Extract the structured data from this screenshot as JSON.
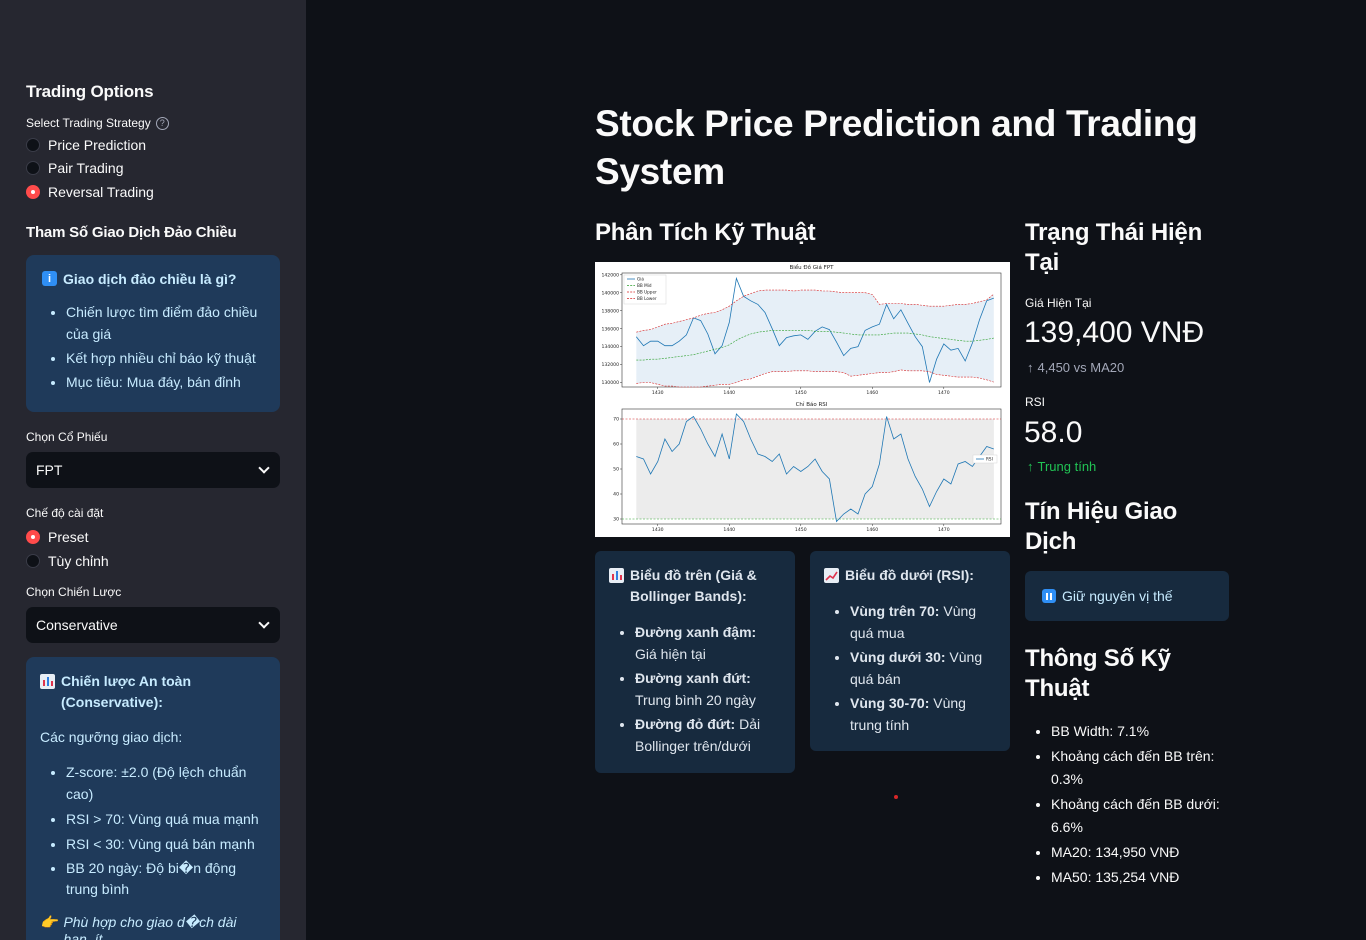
{
  "sidebar": {
    "header": "Trading Options",
    "strategy_label": "Select Trading Strategy",
    "strategies": [
      "Price Prediction",
      "Pair Trading",
      "Reversal Trading"
    ],
    "selected_strategy": "Reversal Trading",
    "params_header": "Tham Số Giao Dịch Đảo Chiều",
    "info": {
      "title": "Giao dịch đảo chiều là gì?",
      "items": [
        "Chiến lược tìm điểm đảo chiều của giá",
        "Kết hợp nhiều chỉ báo kỹ thuật",
        "Mục tiêu: Mua đáy, bán đỉnh"
      ]
    },
    "stock_label": "Chọn Cổ Phiếu",
    "stock_value": "FPT",
    "mode_label": "Chế độ cài đặt",
    "modes": [
      "Preset",
      "Tùy chỉnh"
    ],
    "selected_mode": "Preset",
    "strategy_select_label": "Chọn Chiến Lược",
    "strategy_select_value": "Conservative",
    "strategy_info": {
      "title": "Chiến lược An toàn (Conservative):",
      "subtitle": "Các ngưỡng giao dịch:",
      "items": [
        "Z-score: ±2.0 (Độ lệch chuẩn cao)",
        "RSI > 70: Vùng quá mua mạnh",
        "RSI < 30: Vùng quá bán mạnh",
        "BB 20 ngày: Độ bi�n động trung bình"
      ],
      "note": "Phù hợp cho giao d�ch dài hạn, ít"
    }
  },
  "main": {
    "title": "Stock Price Prediction and Trading System",
    "tech_header": "Phân Tích Kỹ Thuật",
    "status_header": "Trạng Thái Hiện Tại",
    "price_label": "Giá Hiện Tại",
    "price_value": "139,400 VNĐ",
    "price_delta": "4,450 vs MA20",
    "rsi_label": "RSI",
    "rsi_value": "58.0",
    "rsi_delta": "Trung tính",
    "signal_header": "Tín Hiệu Giao Dịch",
    "signal_text": "Giữ nguyên vị thế",
    "params_header": "Thông Số Kỹ Thuật",
    "params": [
      "BB Width: 7.1%",
      "Khoảng cách đến BB trên: 0.3%",
      "Khoảng cách đến BB dưới: 6.6%",
      "MA20: 134,950 VNĐ",
      "MA50: 135,254 VNĐ"
    ],
    "card_top": {
      "title": "Biểu đồ trên (Giá & Bollinger Bands):",
      "items": [
        {
          "bold": "Đường xanh đậm:",
          "text": " Giá hiện tại"
        },
        {
          "bold": "Đường xanh đứt:",
          "text": " Trung bình 20 ngày"
        },
        {
          "bold": "Đường đỏ đứt:",
          "text": " Dải Bollinger trên/dưới"
        }
      ]
    },
    "card_bottom": {
      "title": "Biểu đồ dưới (RSI):",
      "items": [
        {
          "bold": "Vùng trên 70:",
          "text": " Vùng quá mua"
        },
        {
          "bold": "Vùng dưới 30:",
          "text": " Vùng quá bán"
        },
        {
          "bold": "Vùng 30-70:",
          "text": " Vùng trung tính"
        }
      ]
    }
  },
  "chart_data": [
    {
      "type": "line",
      "title": "Biểu Đồ Giá FPT",
      "x_ticks": [
        1430,
        1440,
        1450,
        1460,
        1470
      ],
      "y_ticks": [
        130000,
        132000,
        134000,
        136000,
        138000,
        140000,
        142000
      ],
      "ylim": [
        129500,
        142200
      ],
      "xlim": [
        1425,
        1478
      ],
      "legend": [
        "Giá",
        "BB Mid",
        "BB Upper",
        "BB Lower"
      ],
      "x": [
        1427,
        1428,
        1429,
        1430,
        1431,
        1432,
        1433,
        1434,
        1435,
        1436,
        1437,
        1438,
        1439,
        1440,
        1441,
        1442,
        1443,
        1444,
        1445,
        1446,
        1447,
        1448,
        1449,
        1450,
        1451,
        1452,
        1453,
        1454,
        1455,
        1456,
        1457,
        1458,
        1459,
        1460,
        1461,
        1462,
        1463,
        1464,
        1465,
        1466,
        1467,
        1468,
        1469,
        1470,
        1471,
        1472,
        1473,
        1474,
        1475,
        1476,
        1477
      ],
      "series": [
        {
          "name": "Giá",
          "color": "#1f77b4",
          "dash": false,
          "values": [
            135100,
            134100,
            134600,
            134600,
            134100,
            134100,
            134600,
            135300,
            137200,
            136900,
            135400,
            133200,
            134100,
            136700,
            141600,
            139600,
            139100,
            138700,
            137800,
            136000,
            134100,
            135000,
            135200,
            135300,
            134800,
            135700,
            136200,
            135900,
            134500,
            133000,
            133800,
            134000,
            135800,
            136200,
            136500,
            138700,
            137100,
            138100,
            136600,
            135100,
            134000,
            130000,
            132600,
            134300,
            133600,
            133800,
            132400,
            134400,
            137000,
            139100,
            139400
          ]
        },
        {
          "name": "BB Mid",
          "color": "#2ca02c",
          "dash": true,
          "values": [
            132500,
            132500,
            132600,
            132600,
            132700,
            132800,
            132900,
            133000,
            133100,
            133300,
            133500,
            133700,
            133900,
            134200,
            134700,
            135100,
            135400,
            135600,
            135700,
            135800,
            135800,
            135800,
            135800,
            135800,
            135800,
            135700,
            135700,
            135700,
            135600,
            135500,
            135400,
            135300,
            135300,
            135300,
            135300,
            135400,
            135500,
            135500,
            135500,
            135400,
            135300,
            135100,
            135000,
            134900,
            134800,
            134700,
            134600,
            134600,
            134700,
            134800,
            134950
          ]
        },
        {
          "name": "BB Upper",
          "color": "#d62728",
          "dash": true,
          "values": [
            135600,
            135800,
            135900,
            136200,
            136500,
            136600,
            136800,
            137000,
            137200,
            137500,
            137700,
            137800,
            138100,
            138500,
            139100,
            139600,
            139900,
            140200,
            140300,
            140300,
            140300,
            140300,
            140200,
            140300,
            140300,
            140300,
            140200,
            140200,
            140100,
            140000,
            140000,
            140000,
            140000,
            139800,
            138700,
            138800,
            138800,
            138800,
            138700,
            138700,
            138600,
            138500,
            138500,
            138500,
            138600,
            138700,
            138700,
            138800,
            139000,
            139200,
            139850
          ]
        },
        {
          "name": "BB Lower",
          "color": "#d62728",
          "dash": true,
          "values": [
            129900,
            130000,
            130000,
            129800,
            129600,
            129600,
            129500,
            129500,
            129500,
            129500,
            129600,
            129700,
            129800,
            129800,
            130000,
            130300,
            130400,
            130700,
            131000,
            131200,
            131200,
            131200,
            131300,
            131300,
            131300,
            131200,
            131200,
            131200,
            131200,
            131100,
            130700,
            130800,
            130900,
            131000,
            131100,
            131100,
            131200,
            131400,
            131300,
            131300,
            131300,
            131200,
            130900,
            130800,
            130700,
            130600,
            130600,
            130600,
            130500,
            130300,
            130050
          ]
        }
      ]
    },
    {
      "type": "line",
      "title": "Chỉ Báo RSI",
      "x_ticks": [
        1430,
        1440,
        1450,
        1460,
        1470
      ],
      "y_ticks": [
        30,
        40,
        50,
        60,
        70
      ],
      "ylim": [
        28,
        74
      ],
      "xlim": [
        1425,
        1478
      ],
      "legend": [
        "RSI"
      ],
      "reference_lines": [
        70,
        30
      ],
      "x": [
        1427,
        1428,
        1429,
        1430,
        1431,
        1432,
        1433,
        1434,
        1435,
        1436,
        1437,
        1438,
        1439,
        1440,
        1441,
        1442,
        1443,
        1444,
        1445,
        1446,
        1447,
        1448,
        1449,
        1450,
        1451,
        1452,
        1453,
        1454,
        1455,
        1456,
        1457,
        1458,
        1459,
        1460,
        1461,
        1462,
        1463,
        1464,
        1465,
        1466,
        1467,
        1468,
        1469,
        1470,
        1471,
        1472,
        1473,
        1474,
        1475,
        1476,
        1477
      ],
      "series": [
        {
          "name": "RSI",
          "color": "#1f77b4",
          "dash": false,
          "values": [
            55,
            54,
            48,
            53,
            62,
            57,
            60,
            69,
            71,
            66,
            60,
            55,
            64,
            54,
            72,
            69,
            62,
            56,
            55,
            53,
            56,
            48,
            51,
            49,
            51,
            54,
            49,
            46,
            29,
            32,
            34,
            32,
            40,
            43,
            52,
            71,
            62,
            64,
            54,
            47,
            42,
            35,
            41,
            46,
            44,
            52,
            53,
            51,
            55,
            59,
            58
          ]
        }
      ]
    }
  ]
}
